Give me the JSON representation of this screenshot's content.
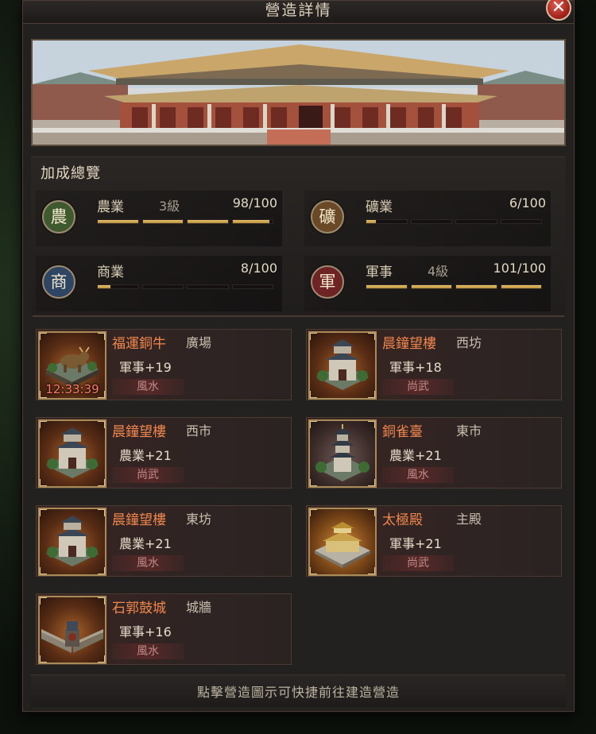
{
  "dialog": {
    "title": "營造詳情",
    "close_label": "✕"
  },
  "bonus_overview": {
    "title": "加成總覽",
    "items": [
      {
        "emblem": "農",
        "name": "農業",
        "level": "3級",
        "value": "98/100",
        "emblem_color": "#3f5a2e",
        "progress": 0.98
      },
      {
        "emblem": "礦",
        "name": "礦業",
        "level": "",
        "value": "6/100",
        "emblem_color": "#6a4a26",
        "progress": 0.06
      },
      {
        "emblem": "商",
        "name": "商業",
        "level": "",
        "value": "8/100",
        "emblem_color": "#2e4563",
        "progress": 0.08
      },
      {
        "emblem": "軍",
        "name": "軍事",
        "level": "4級",
        "value": "101/100",
        "emblem_color": "#6e2425",
        "progress": 1.0
      }
    ]
  },
  "buildings": [
    {
      "name": "福運銅牛",
      "location": "廣場",
      "bonus": "軍事+19",
      "tag": "風水",
      "timer": "12:33:39",
      "icon": "bronze-ox-icon"
    },
    {
      "name": "晨鐘望樓",
      "location": "西坊",
      "bonus": "軍事+18",
      "tag": "尚武",
      "timer": "",
      "icon": "watchtower-icon"
    },
    {
      "name": "晨鐘望樓",
      "location": "西市",
      "bonus": "農業+21",
      "tag": "尚武",
      "timer": "",
      "icon": "watchtower-icon"
    },
    {
      "name": "銅雀臺",
      "location": "東市",
      "bonus": "農業+21",
      "tag": "風水",
      "timer": "",
      "icon": "pagoda-icon"
    },
    {
      "name": "晨鐘望樓",
      "location": "東坊",
      "bonus": "農業+21",
      "tag": "風水",
      "timer": "",
      "icon": "watchtower-icon"
    },
    {
      "name": "太極殿",
      "location": "主殿",
      "bonus": "軍事+21",
      "tag": "尚武",
      "timer": "",
      "icon": "palace-icon"
    },
    {
      "name": "石郭鼓城",
      "location": "城牆",
      "bonus": "軍事+16",
      "tag": "風水",
      "timer": "",
      "icon": "city-wall-icon"
    }
  ],
  "footer": {
    "hint": "點擊營造圖示可快捷前往建造營造"
  }
}
